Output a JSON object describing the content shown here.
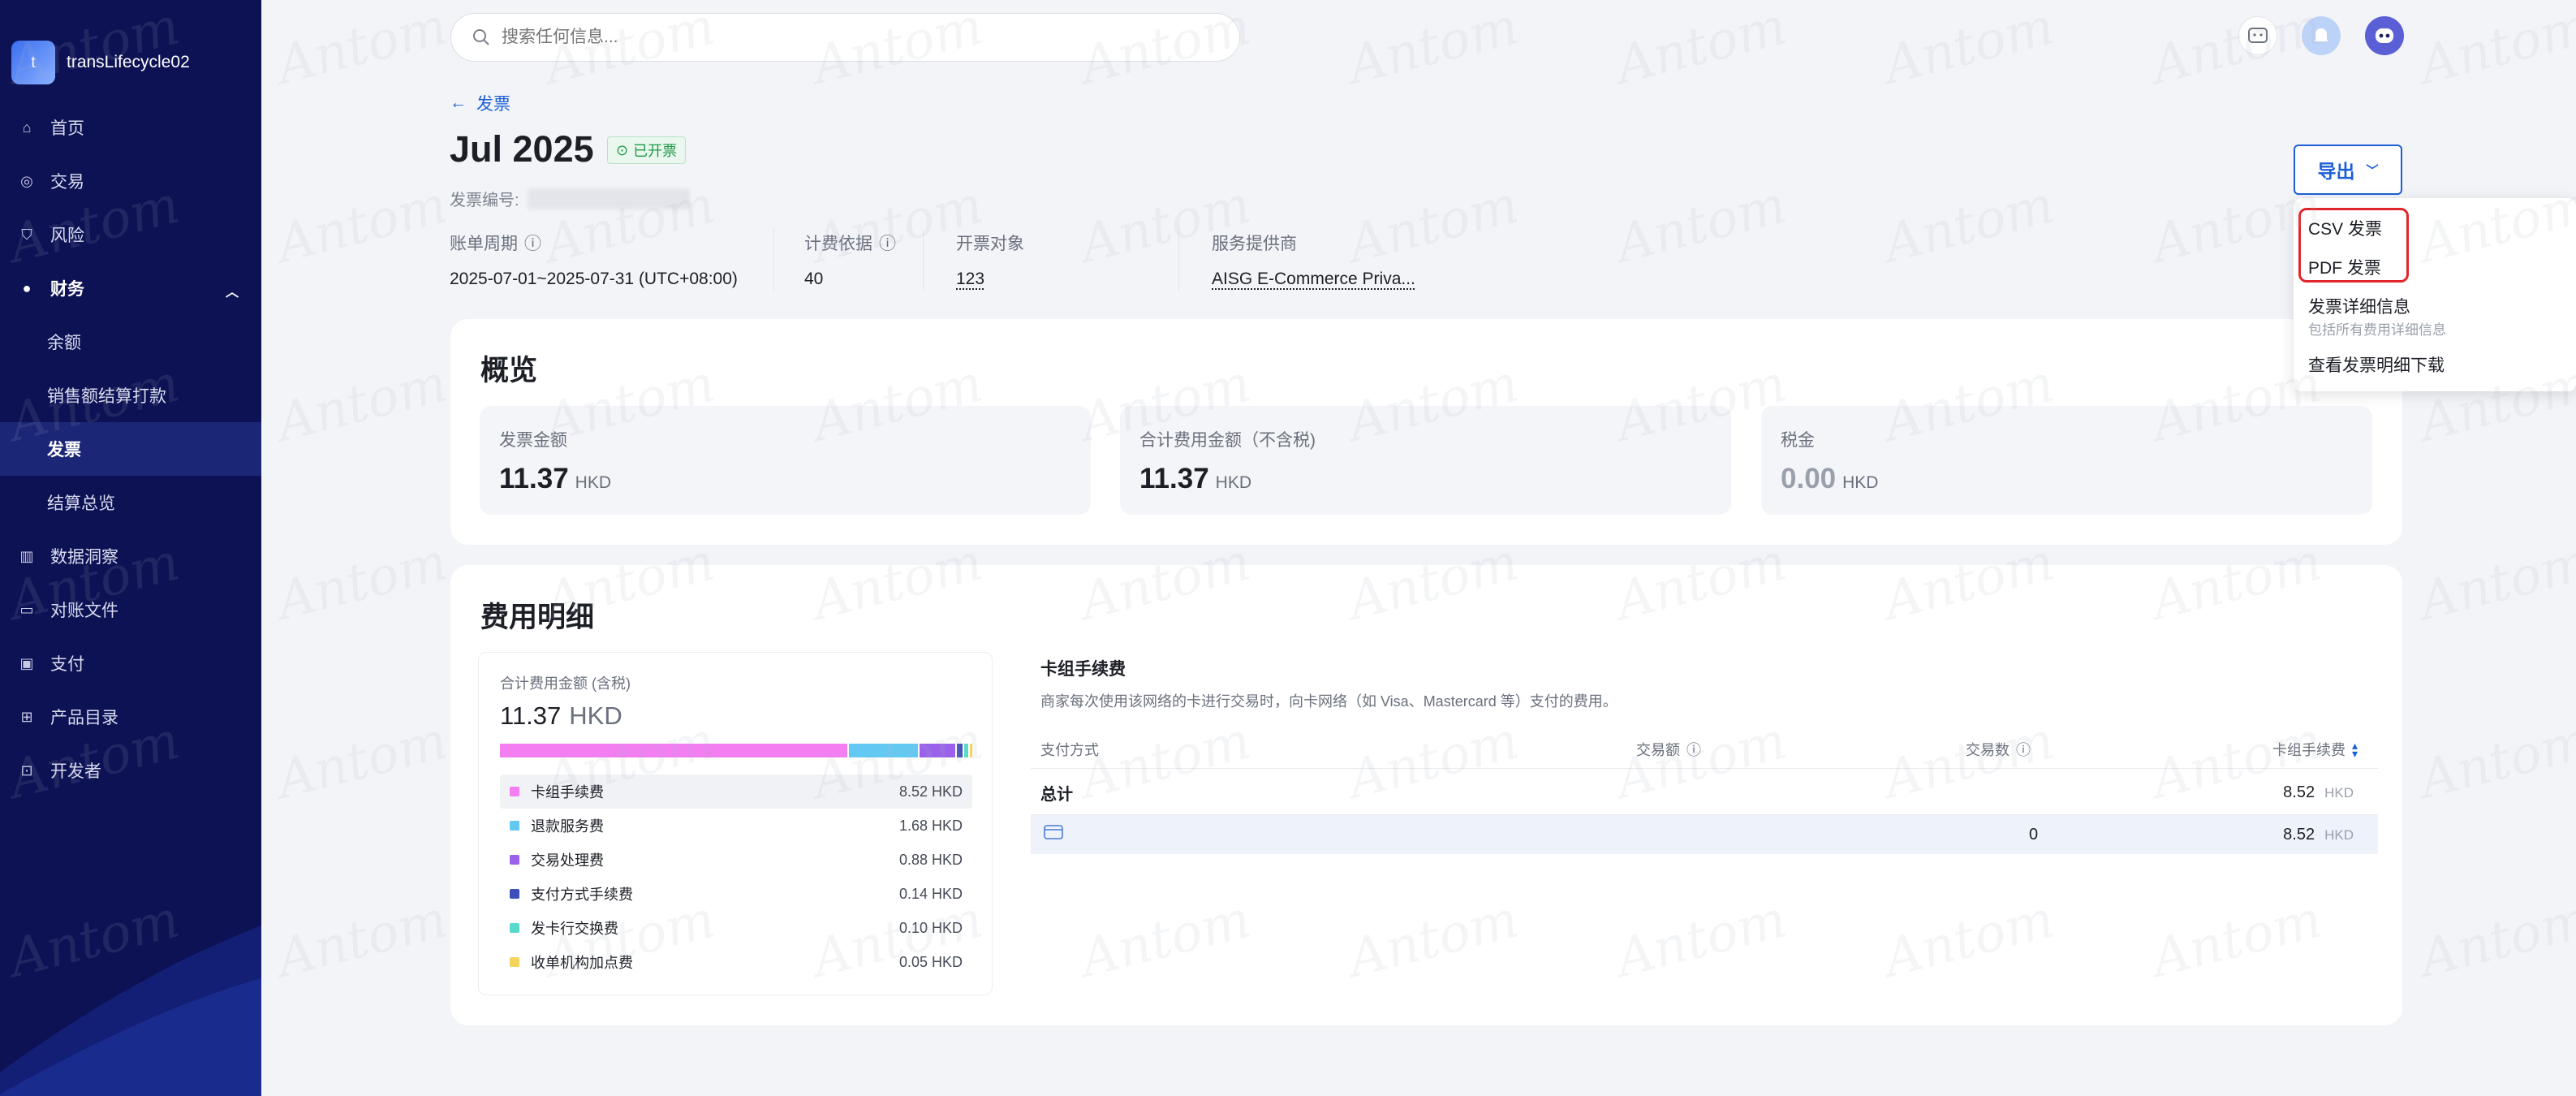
{
  "app": {
    "workspace": "transLifecycle02",
    "logo_initial": "t"
  },
  "sidebar": {
    "items": [
      {
        "label": "首页",
        "icon": "home-icon",
        "glyph": "⌂"
      },
      {
        "label": "交易",
        "icon": "transactions-icon",
        "glyph": "◎"
      },
      {
        "label": "风险",
        "icon": "risk-shield-icon",
        "glyph": "⛉"
      },
      {
        "label": "财务",
        "icon": "finance-bag-icon",
        "glyph": "●"
      },
      {
        "label": "余额"
      },
      {
        "label": "销售额结算打款"
      },
      {
        "label": "发票"
      },
      {
        "label": "结算总览"
      },
      {
        "label": "数据洞察",
        "icon": "chart-icon",
        "glyph": "▥"
      },
      {
        "label": "对账文件",
        "icon": "file-icon",
        "glyph": "▭"
      },
      {
        "label": "支付",
        "icon": "wallet-icon",
        "glyph": "▣"
      },
      {
        "label": "产品目录",
        "icon": "grid-icon",
        "glyph": "⊞"
      },
      {
        "label": "开发者",
        "icon": "terminal-icon",
        "glyph": "⊡"
      }
    ]
  },
  "search": {
    "placeholder": "搜索任何信息..."
  },
  "header": {
    "back_label": "发票",
    "title": "Jul 2025",
    "status": "已开票",
    "invoice_no_label": "发票编号:",
    "meta": [
      {
        "label": "账单周期",
        "value": "2025-07-01~2025-07-31 (UTC+08:00)"
      },
      {
        "label": "计费依据",
        "value": "40"
      },
      {
        "label": "开票对象",
        "value": "123"
      },
      {
        "label": "服务提供商",
        "value": "AISG E-Commerce Priva..."
      }
    ],
    "export_label": "导出"
  },
  "overview": {
    "title": "概览",
    "stats": [
      {
        "label": "发票金额",
        "value": "11.37",
        "currency": "HKD"
      },
      {
        "label": "合计费用金额（不含税)",
        "value": "11.37",
        "currency": "HKD"
      },
      {
        "label": "税金",
        "value": "0.00",
        "currency": "HKD"
      }
    ]
  },
  "fees": {
    "title": "费用明细",
    "total_label": "合计费用金额 (含税)",
    "total_value": "11.37",
    "total_currency": "HKD",
    "breakdown": [
      {
        "name": "卡组手续费",
        "value": "8.52 HKD",
        "amount": 8.52,
        "color": "#f27ef2"
      },
      {
        "name": "退款服务费",
        "value": "1.68 HKD",
        "amount": 1.68,
        "color": "#64c9f2"
      },
      {
        "name": "交易处理费",
        "value": "0.88 HKD",
        "amount": 0.88,
        "color": "#9a62ea"
      },
      {
        "name": "支付方式手续费",
        "value": "0.14 HKD",
        "amount": 0.14,
        "color": "#3d4fb8"
      },
      {
        "name": "发卡行交换费",
        "value": "0.10 HKD",
        "amount": 0.1,
        "color": "#59d9c9"
      },
      {
        "name": "收单机构加点费",
        "value": "0.05 HKD",
        "amount": 0.05,
        "color": "#f5d35c"
      }
    ],
    "table": {
      "title": "卡组手续费",
      "description": "商家每次使用该网络的卡进行交易时，向卡网络（如 Visa、Mastercard 等）支付的费用。",
      "columns": [
        "支付方式",
        "交易额",
        "交易数",
        "卡组手续费"
      ],
      "total_row": {
        "label": "总计",
        "fee": "8.52",
        "currency": "HKD"
      },
      "rows": [
        {
          "payment_method_icon": "card-icon",
          "count": "0",
          "fee": "8.52",
          "currency": "HKD"
        }
      ]
    }
  },
  "export_menu": {
    "items": [
      {
        "label": "CSV 发票"
      },
      {
        "label": "PDF 发票"
      },
      {
        "label": "发票详细信息",
        "sub": "包括所有费用详细信息"
      },
      {
        "label": "查看发票明细下载"
      }
    ]
  },
  "watermark": "Antom",
  "colors": {
    "sidebar_bg": "#0d1254",
    "accent": "#1d5fd6",
    "status_green": "#1f9a48",
    "highlight_red": "#e0262b"
  }
}
